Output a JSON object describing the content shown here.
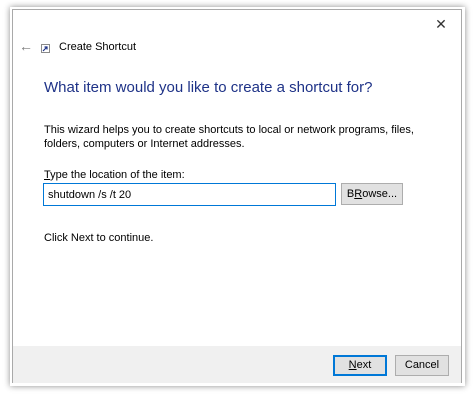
{
  "window": {
    "close_glyph": "✕",
    "back_glyph": "←",
    "title": "Create Shortcut"
  },
  "main": {
    "heading": "What item would you like to create a shortcut for?",
    "description": "This wizard helps you to create shortcuts to local or network programs, files, folders, computers or Internet addresses.",
    "location_label_accel": "T",
    "location_label_rest": "ype the location of the item:",
    "location_value": "shutdown /s /t 20",
    "browse_accel": "R",
    "browse_label_pre": "B",
    "browse_label_post": "owse...",
    "continue_text": "Click Next to continue."
  },
  "footer": {
    "next_accel": "N",
    "next_rest": "ext",
    "cancel_label": "Cancel"
  },
  "colors": {
    "heading": "#1e3287",
    "accent": "#0078d7",
    "footer_bg": "#f0f0f0"
  },
  "icons": {
    "close": "close-icon",
    "back": "back-arrow-icon",
    "wizard": "shortcut-icon"
  }
}
